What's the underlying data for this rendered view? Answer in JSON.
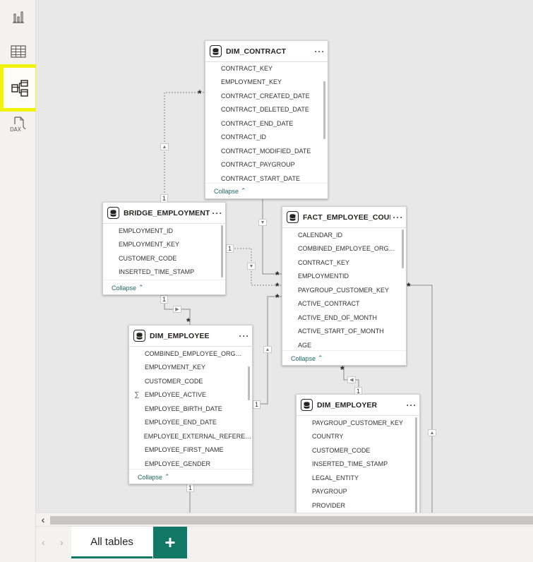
{
  "rail": {
    "items": [
      {
        "name": "report-view",
        "icon": "bar-chart-icon"
      },
      {
        "name": "table-view",
        "icon": "table-grid-icon"
      },
      {
        "name": "model-view",
        "icon": "model-diagram-icon",
        "active": true
      },
      {
        "name": "dax-query-view",
        "icon": "dax-query-icon",
        "label": "DAX"
      }
    ]
  },
  "tables": {
    "dim_contract": {
      "title": "DIM_CONTRACT",
      "columns": [
        "CONTRACT_KEY",
        "EMPLOYMENT_KEY",
        "CONTRACT_CREATED_DATE",
        "CONTRACT_DELETED_DATE",
        "CONTRACT_END_DATE",
        "CONTRACT_ID",
        "CONTRACT_MODIFIED_DATE",
        "CONTRACT_PAYGROUP",
        "CONTRACT_START_DATE"
      ],
      "collapse": "Collapse"
    },
    "bridge_employment": {
      "title": "BRIDGE_EMPLOYMENT",
      "columns": [
        "EMPLOYMENT_ID",
        "EMPLOYMENT_KEY",
        "CUSTOMER_CODE",
        "INSERTED_TIME_STAMP"
      ],
      "collapse": "Collapse"
    },
    "fact_employee_count": {
      "title": "FACT_EMPLOYEE_COUNT",
      "columns": [
        "CALENDAR_ID",
        "COMBINED_EMPLOYEE_ORGINIZ...",
        "CONTRACT_KEY",
        "EMPLOYMENTID",
        "PAYGROUP_CUSTOMER_KEY",
        "ACTIVE_CONTRACT",
        "ACTIVE_END_OF_MONTH",
        "ACTIVE_START_OF_MONTH",
        "AGE"
      ],
      "collapse": "Collapse"
    },
    "dim_employee": {
      "title": "DIM_EMPLOYEE",
      "columns": [
        "COMBINED_EMPLOYEE_ORGINIZ...",
        "EMPLOYMENT_KEY",
        "CUSTOMER_CODE",
        "EMPLOYEE_ACTIVE",
        "EMPLOYEE_BIRTH_DATE",
        "EMPLOYEE_END_DATE",
        "EMPLOYEE_EXTERNAL_REFERENCE",
        "EMPLOYEE_FIRST_NAME",
        "EMPLOYEE_GENDER"
      ],
      "sigma_column": "EMPLOYEE_ACTIVE",
      "collapse": "Collapse"
    },
    "dim_employer": {
      "title": "DIM_EMPLOYER",
      "columns": [
        "PAYGROUP_CUSTOMER_KEY",
        "COUNTRY",
        "CUSTOMER_CODE",
        "INSERTED_TIME_STAMP",
        "LEGAL_ENTITY",
        "PAYGROUP",
        "PROVIDER"
      ]
    }
  },
  "cardinality": {
    "one": "1",
    "many": "*"
  },
  "tabs": {
    "items": [
      {
        "label": "All tables"
      }
    ],
    "add_label": "+",
    "prev_label": "‹",
    "next_label": "›"
  },
  "scrollbar": {
    "left_label": "‹"
  },
  "colors": {
    "accent": "#117865",
    "highlight": "#f2f20d",
    "canvas": "#e8e8e8"
  }
}
